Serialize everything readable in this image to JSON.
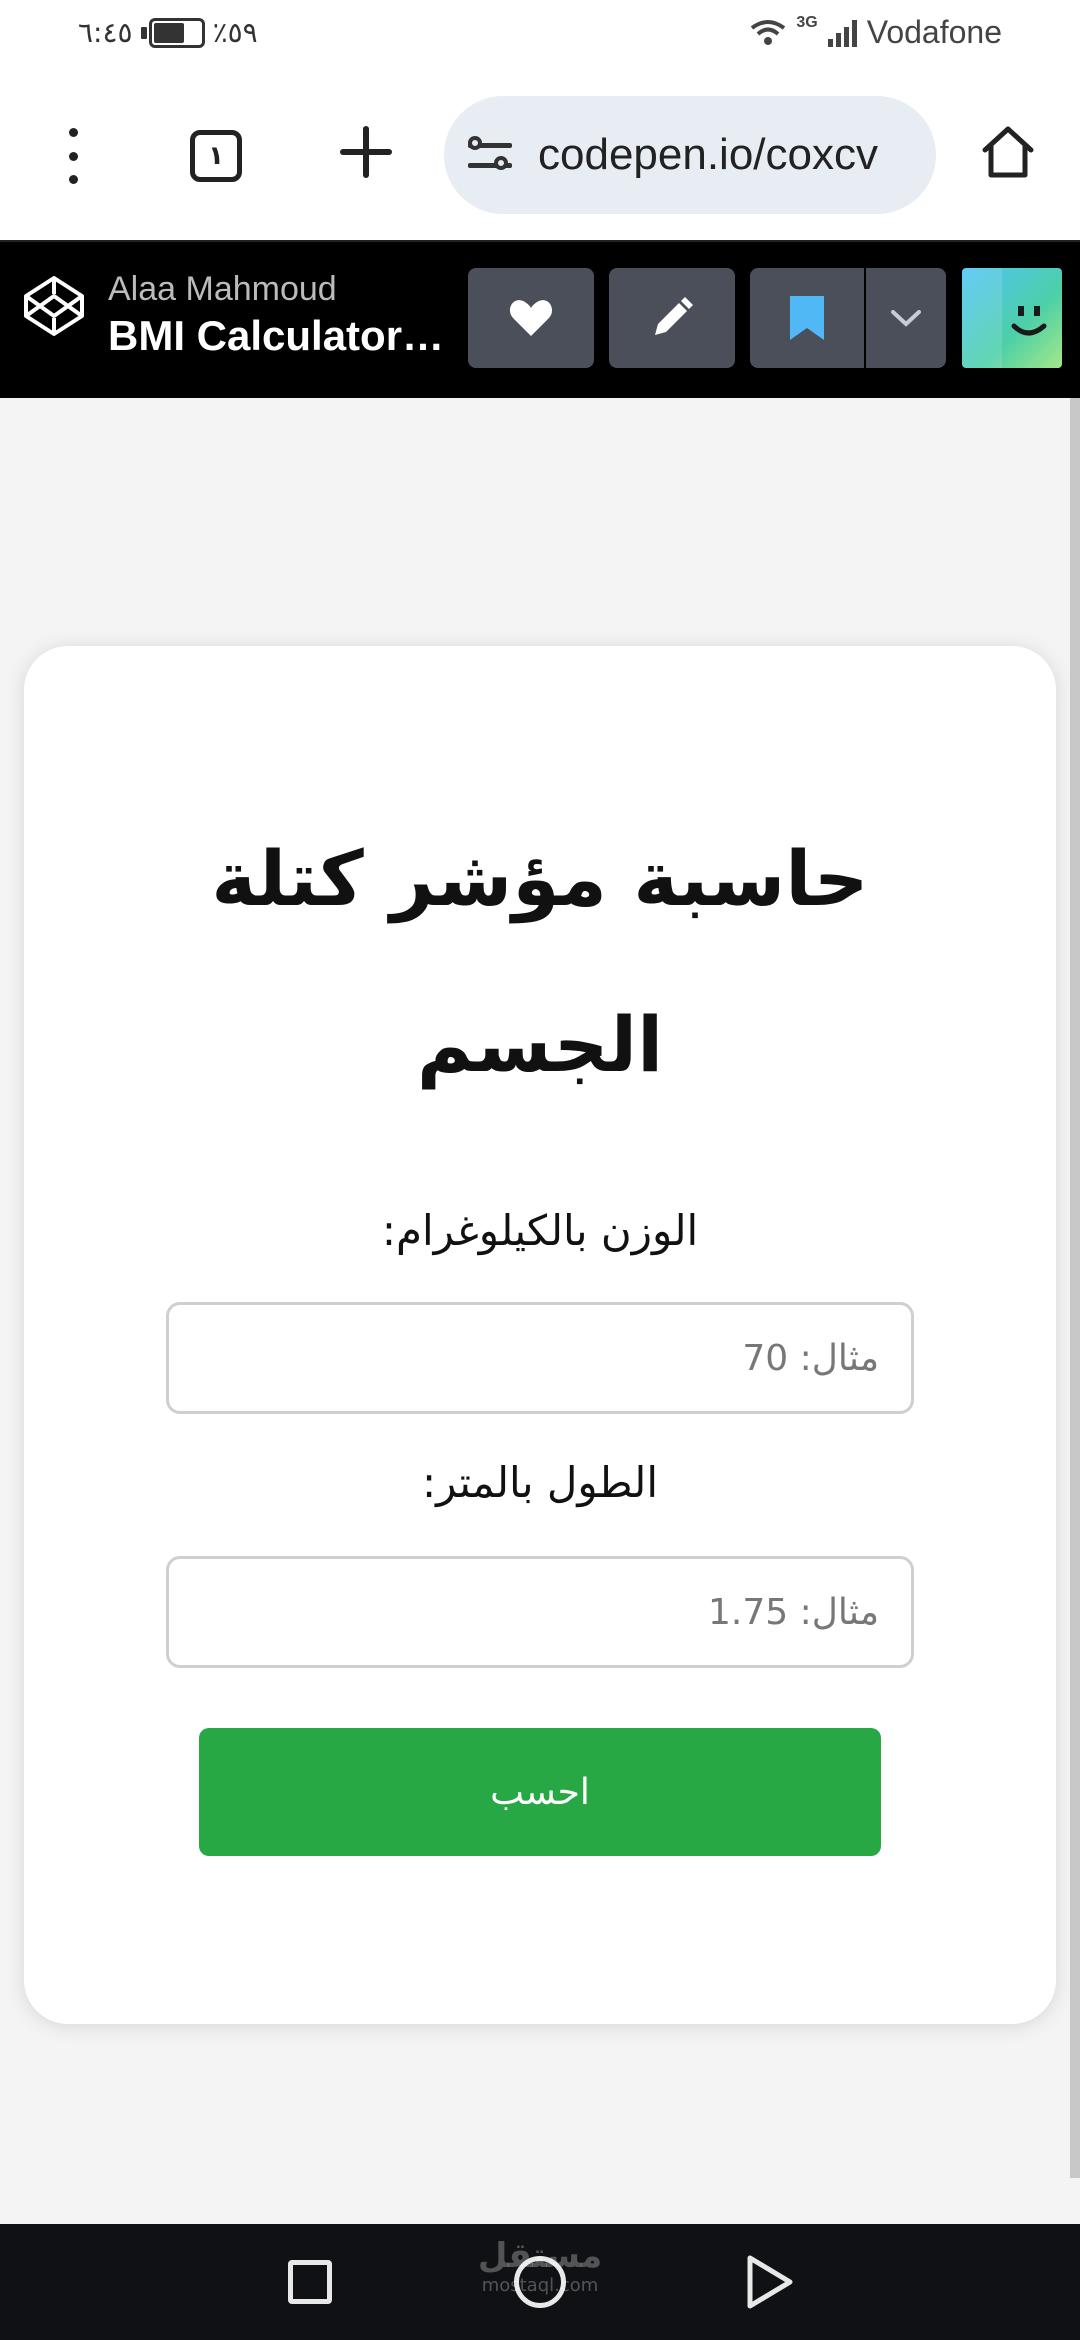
{
  "status_bar": {
    "time": "٦:٤٥",
    "battery": "٪٥٩",
    "network": "3G",
    "carrier": "Vodafone"
  },
  "browser": {
    "tab_count": "١",
    "url": "codepen.io/coxcv"
  },
  "pen_header": {
    "author": "Alaa Mahmoud",
    "title": "BMI Calculator ..."
  },
  "app": {
    "title": "حاسبة مؤشر كتلة الجسم",
    "weight_label": "الوزن بالكيلوغرام:",
    "weight_placeholder": "مثال: 70",
    "height_label": "الطول بالمتر:",
    "height_placeholder": "مثال: 1.75",
    "calculate_button": "احسب"
  },
  "watermark": {
    "arabic": "مستقل",
    "latin": "mostaql.com"
  },
  "colors": {
    "button_green": "#28a745",
    "header_black": "#000000",
    "button_dark": "#4a4f5a",
    "bookmark_blue": "#4fb8f5",
    "page_background": "#f4f4f4"
  }
}
